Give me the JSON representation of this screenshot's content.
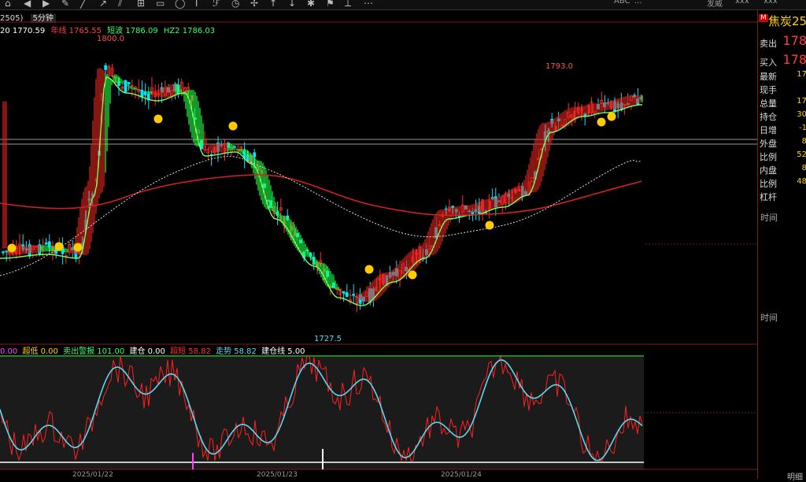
{
  "toolbar": {
    "icons": [
      "home-icon",
      "back-icon",
      "forward-icon",
      "pen-icon",
      "line-icon",
      "ray-icon",
      "channel-icon",
      "grid-icon",
      "rect-icon",
      "circle-icon",
      "text-icon",
      "fib-icon",
      "cycle-icon",
      "gann-icon",
      "arrow-up-icon",
      "arrow-down-icon",
      "mark-icon",
      "flag-icon",
      "ruler-icon",
      "more-icon"
    ],
    "right_labels": [
      "发威",
      "xxx",
      "xxx"
    ],
    "right_small": "ABC",
    "ellipsis": "..."
  },
  "period": {
    "contract": "2505)",
    "interval": "5分钟"
  },
  "indicators": {
    "ma20": "20 1770.59",
    "yearline": "年线 1765.55",
    "short_wave": "短波 1786.09",
    "hz2": "HZ2 1786.03"
  },
  "oscillator": {
    "v0": "0.00",
    "super_low": "超低 0.00",
    "sell_alert": "卖出警报 101.00",
    "build_pos": "建仓 0.00",
    "super_short": "超短 58.82",
    "trend": "走势 58.82",
    "build_line": "建仓线 5.00"
  },
  "price_annotations": {
    "high_left": "1800.0",
    "high_right": "1793.0",
    "low": "1727.5"
  },
  "dates": [
    "2025/01/22",
    "2025/01/23",
    "2025/01/24"
  ],
  "panel": {
    "badge": "M",
    "symbol": "焦炭25",
    "sell_label": "卖出",
    "sell_value": "178",
    "buy_label": "买入",
    "buy_value": "178",
    "rows": [
      {
        "label": "最新",
        "value": "17"
      },
      {
        "label": "现手",
        "value": ""
      },
      {
        "label": "总量",
        "value": "17"
      },
      {
        "label": "持仓",
        "value": "30"
      },
      {
        "label": "日增",
        "value": "-1"
      },
      {
        "label": "外盘",
        "value": "8"
      },
      {
        "label": "比例",
        "value": "52"
      },
      {
        "label": "内盘",
        "value": "8"
      },
      {
        "label": "比例",
        "value": "48"
      },
      {
        "label": "杠杆",
        "value": ""
      }
    ],
    "time_label_1": "时间",
    "time_label_2": "时间",
    "bottom": "明细"
  },
  "colors": {
    "up": "#ff2d2d",
    "down": "#00e5ff",
    "ribbon_up": "#e0241f",
    "ribbon_down": "#22ff44",
    "yearline": "#d42020",
    "osc_fast": "#ff2020",
    "osc_slow": "#5ad8f0",
    "label_yellow": "#ffd200"
  }
}
